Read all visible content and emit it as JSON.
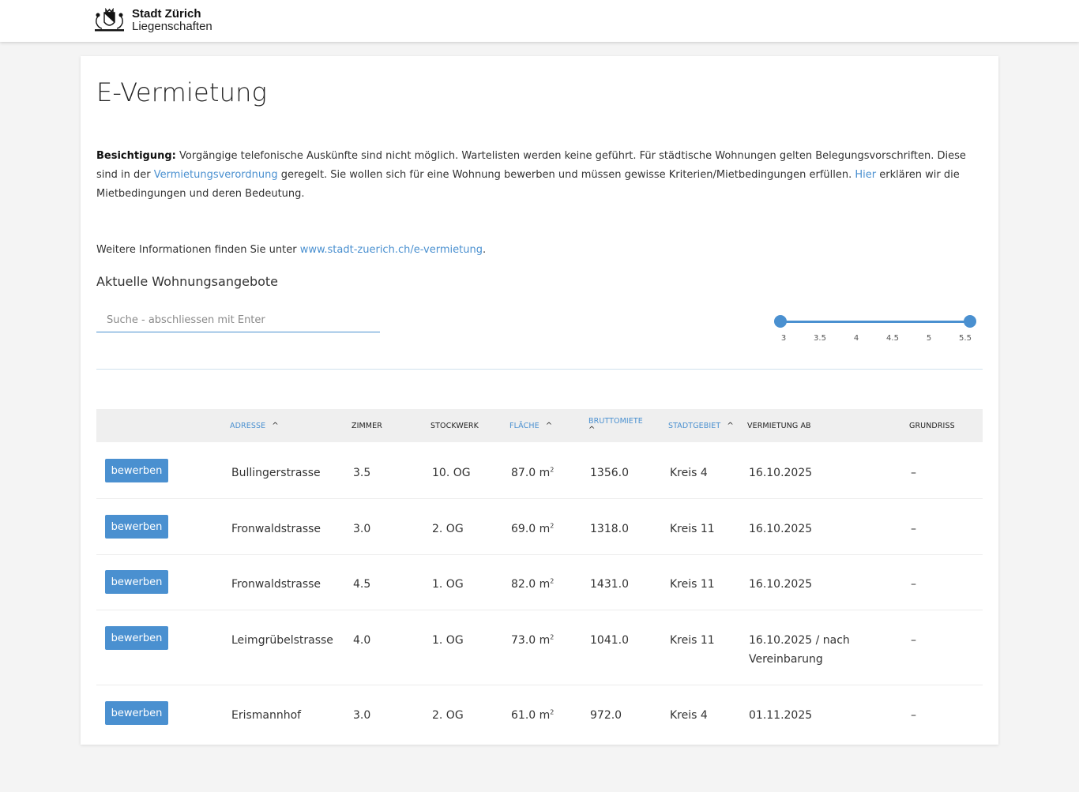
{
  "header": {
    "logo_title": "Stadt Zürich",
    "logo_subtitle": "Liegenschaften"
  },
  "page": {
    "title": "E-Vermietung",
    "intro_bold": "Besichtigung:",
    "intro_text1": " Vorgängige telefonische Auskünfte sind nicht möglich. Wartelisten werden keine geführt. Für städtische Wohnungen gelten Belegungsvorschriften. Diese sind in der ",
    "intro_link1": "Vermietungsverordnung",
    "intro_text2": " geregelt. Sie wollen sich für eine Wohnung bewerben und müssen gewisse Kriterien/Mietbedingungen erfüllen. ",
    "intro_link2": "Hier",
    "intro_text3": " erklären wir die Mietbedingungen und deren Bedeutung.",
    "more_text": "Weitere Informationen finden Sie unter ",
    "more_link": "www.stadt-zuerich.ch/e-vermietung",
    "more_end": ".",
    "section_title": "Aktuelle Wohnungsangebote"
  },
  "search": {
    "placeholder": "Suche - abschliessen mit Enter",
    "value": ""
  },
  "room_filter": {
    "min": 3,
    "max": 5.5,
    "selected_min": 3,
    "selected_max": 5.5,
    "ticks": [
      "3",
      "3.5",
      "4",
      "4.5",
      "5",
      "5.5"
    ],
    "accent_color": "#4a90d0"
  },
  "table": {
    "headers": {
      "adresse": "ADRESSE",
      "zimmer": "ZIMMER",
      "stockwerk": "STOCKWERK",
      "flaeche": "FLÄCHE",
      "bruttomiete": "BRUTTOMIETE",
      "stadtgebiet": "STADTGEBIET",
      "vermietung_ab": "VERMIETUNG AB",
      "grundriss": "GRUNDRISS"
    },
    "button_label": "bewerben",
    "area_unit": "m",
    "area_exp": "2",
    "rows": [
      {
        "adresse": "Bullingerstrasse",
        "zimmer": "3.5",
        "stockwerk": "10. OG",
        "flaeche": "87.0",
        "bruttomiete": "1356.0",
        "stadtgebiet": "Kreis 4",
        "vermietung_line1": "16.10.2025",
        "vermietung_line2": "",
        "grundriss": "–"
      },
      {
        "adresse": "Fronwaldstrasse",
        "zimmer": "3.0",
        "stockwerk": "2. OG",
        "flaeche": "69.0",
        "bruttomiete": "1318.0",
        "stadtgebiet": "Kreis 11",
        "vermietung_line1": "16.10.2025",
        "vermietung_line2": "",
        "grundriss": "–"
      },
      {
        "adresse": "Fronwaldstrasse",
        "zimmer": "4.5",
        "stockwerk": "1. OG",
        "flaeche": "82.0",
        "bruttomiete": "1431.0",
        "stadtgebiet": "Kreis 11",
        "vermietung_line1": "16.10.2025",
        "vermietung_line2": "",
        "grundriss": "–"
      },
      {
        "adresse": "Leimgrübelstrasse",
        "zimmer": "4.0",
        "stockwerk": "1. OG",
        "flaeche": "73.0",
        "bruttomiete": "1041.0",
        "stadtgebiet": "Kreis 11",
        "vermietung_line1": "16.10.2025 / nach",
        "vermietung_line2": "Vereinbarung",
        "grundriss": "–"
      },
      {
        "adresse": "Erismannhof",
        "zimmer": "3.0",
        "stockwerk": "2. OG",
        "flaeche": "61.0",
        "bruttomiete": "972.0",
        "stadtgebiet": "Kreis 4",
        "vermietung_line1": "01.11.2025",
        "vermietung_line2": "",
        "grundriss": "–"
      }
    ]
  },
  "icons": {
    "logo": "zurich-coat-of-arms-icon",
    "sort": "caret-up-icon"
  }
}
